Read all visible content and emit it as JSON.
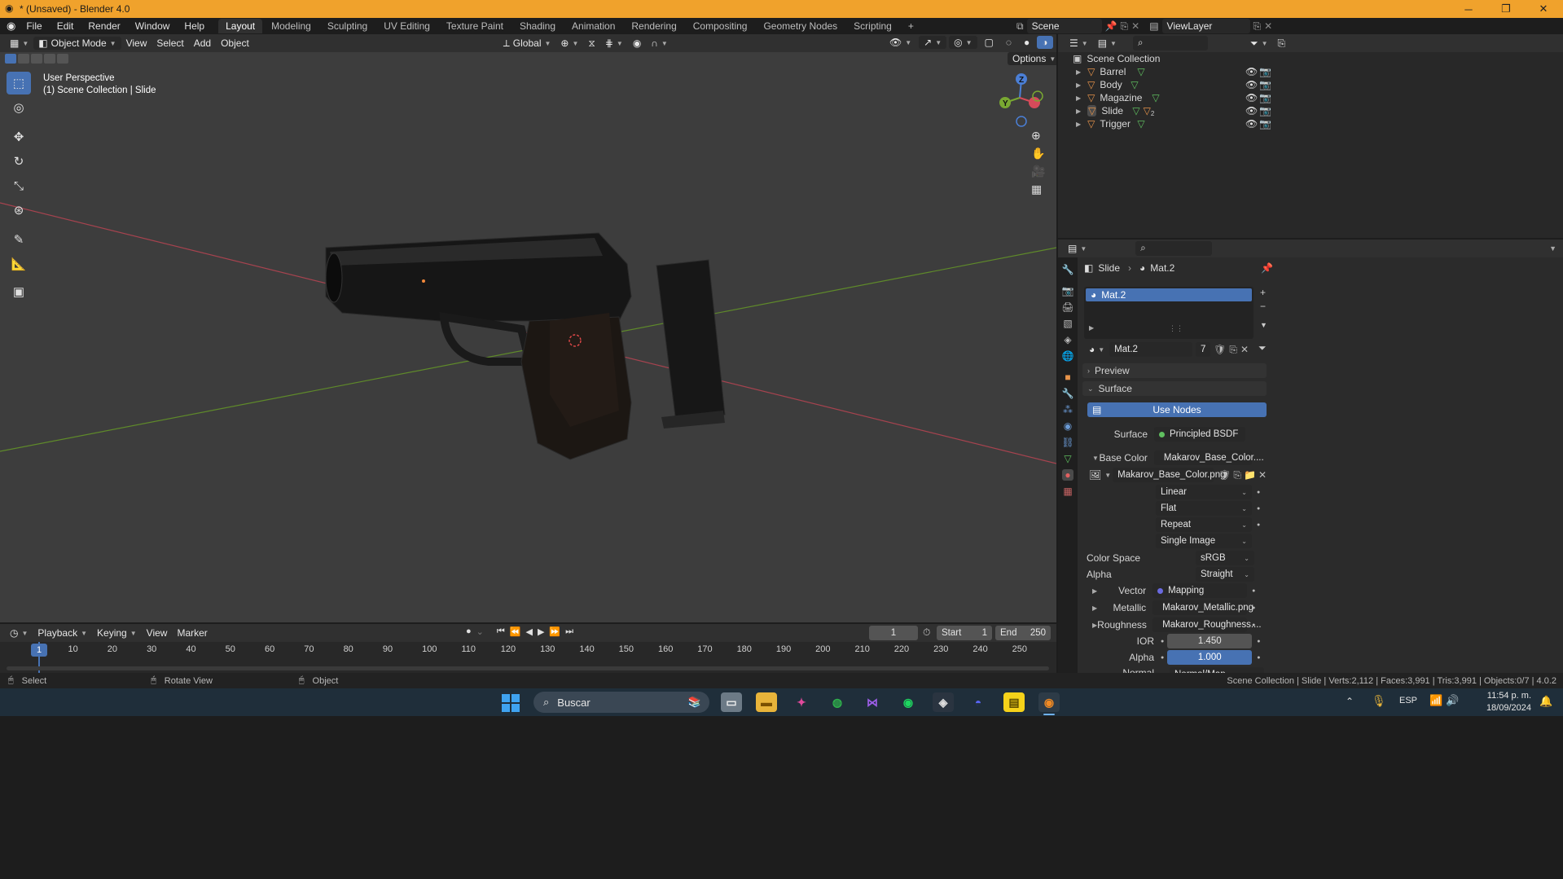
{
  "titlebar": {
    "title": "* (Unsaved) - Blender 4.0"
  },
  "menu": [
    "File",
    "Edit",
    "Render",
    "Window",
    "Help"
  ],
  "workspaces": [
    "Layout",
    "Modeling",
    "Sculpting",
    "UV Editing",
    "Texture Paint",
    "Shading",
    "Animation",
    "Rendering",
    "Compositing",
    "Geometry Nodes",
    "Scripting"
  ],
  "scene": {
    "name": "Scene",
    "view_layer": "ViewLayer"
  },
  "viewport_header": {
    "mode": "Object Mode",
    "view": "View",
    "select": "Select",
    "add": "Add",
    "object": "Object",
    "orientation": "Global",
    "options": "Options"
  },
  "viewport": {
    "overlay_line1": "User Perspective",
    "overlay_line2": "(1) Scene Collection | Slide",
    "gizmo_x": "X",
    "gizmo_y": "Y",
    "gizmo_z": "Z"
  },
  "outliner": {
    "root": "Scene Collection",
    "items": [
      {
        "name": "Barrel",
        "badge": ""
      },
      {
        "name": "Body",
        "badge": ""
      },
      {
        "name": "Magazine",
        "badge": ""
      },
      {
        "name": "Slide",
        "badge": "2"
      },
      {
        "name": "Trigger",
        "badge": ""
      }
    ]
  },
  "properties": {
    "breadcrumb_object": "Slide",
    "breadcrumb_material": "Mat.2",
    "slot_name": "Mat.2",
    "material_name": "Mat.2",
    "user_count": "7",
    "preview_label": "Preview",
    "surface_section": "Surface",
    "use_nodes": "Use Nodes",
    "surface_label": "Surface",
    "surface_value": "Principled BSDF",
    "base_color_label": "Base Color",
    "base_color_value": "Makarov_Base_Color....",
    "image_name": "Makarov_Base_Color.png",
    "interpolation": "Linear",
    "projection": "Flat",
    "extension": "Repeat",
    "source": "Single Image",
    "color_space_label": "Color Space",
    "color_space": "sRGB",
    "alpha_mode_label": "Alpha",
    "alpha_mode": "Straight",
    "vector_label": "Vector",
    "vector_value": "Mapping",
    "metallic_label": "Metallic",
    "metallic_value": "Makarov_Metallic.png",
    "roughness_label": "Roughness",
    "roughness_value": "Makarov_Roughness....",
    "ior_label": "IOR",
    "ior_value": "1.450",
    "alpha_label": "Alpha",
    "alpha_value": "1.000",
    "normal_label": "Normal",
    "normal_value": "Normal/Map"
  },
  "timeline": {
    "menus": [
      "Playback",
      "Keying",
      "View",
      "Marker"
    ],
    "current_frame": "1",
    "start_label": "Start",
    "start": "1",
    "end_label": "End",
    "end": "250",
    "ticks": [
      "1",
      "10",
      "20",
      "30",
      "40",
      "50",
      "60",
      "70",
      "80",
      "90",
      "100",
      "110",
      "120",
      "130",
      "140",
      "150",
      "160",
      "170",
      "180",
      "190",
      "200",
      "210",
      "220",
      "230",
      "240",
      "250"
    ]
  },
  "statusbar": {
    "select": "Select",
    "rotate": "Rotate View",
    "object": "Object",
    "stats": "Scene Collection | Slide | Verts:2,112 | Faces:3,991 | Tris:3,991 | Objects:0/7 | 4.0.2"
  },
  "taskbar": {
    "search": "Buscar",
    "lang": "ESP",
    "time": "11:54 p. m.",
    "date": "18/09/2024"
  },
  "colors": {
    "accent": "#4772b3",
    "titlebar": "#f0a22c",
    "viewport": "#3d3d3d",
    "x_axis": "#b34b58",
    "y_axis": "#6b8e23"
  }
}
